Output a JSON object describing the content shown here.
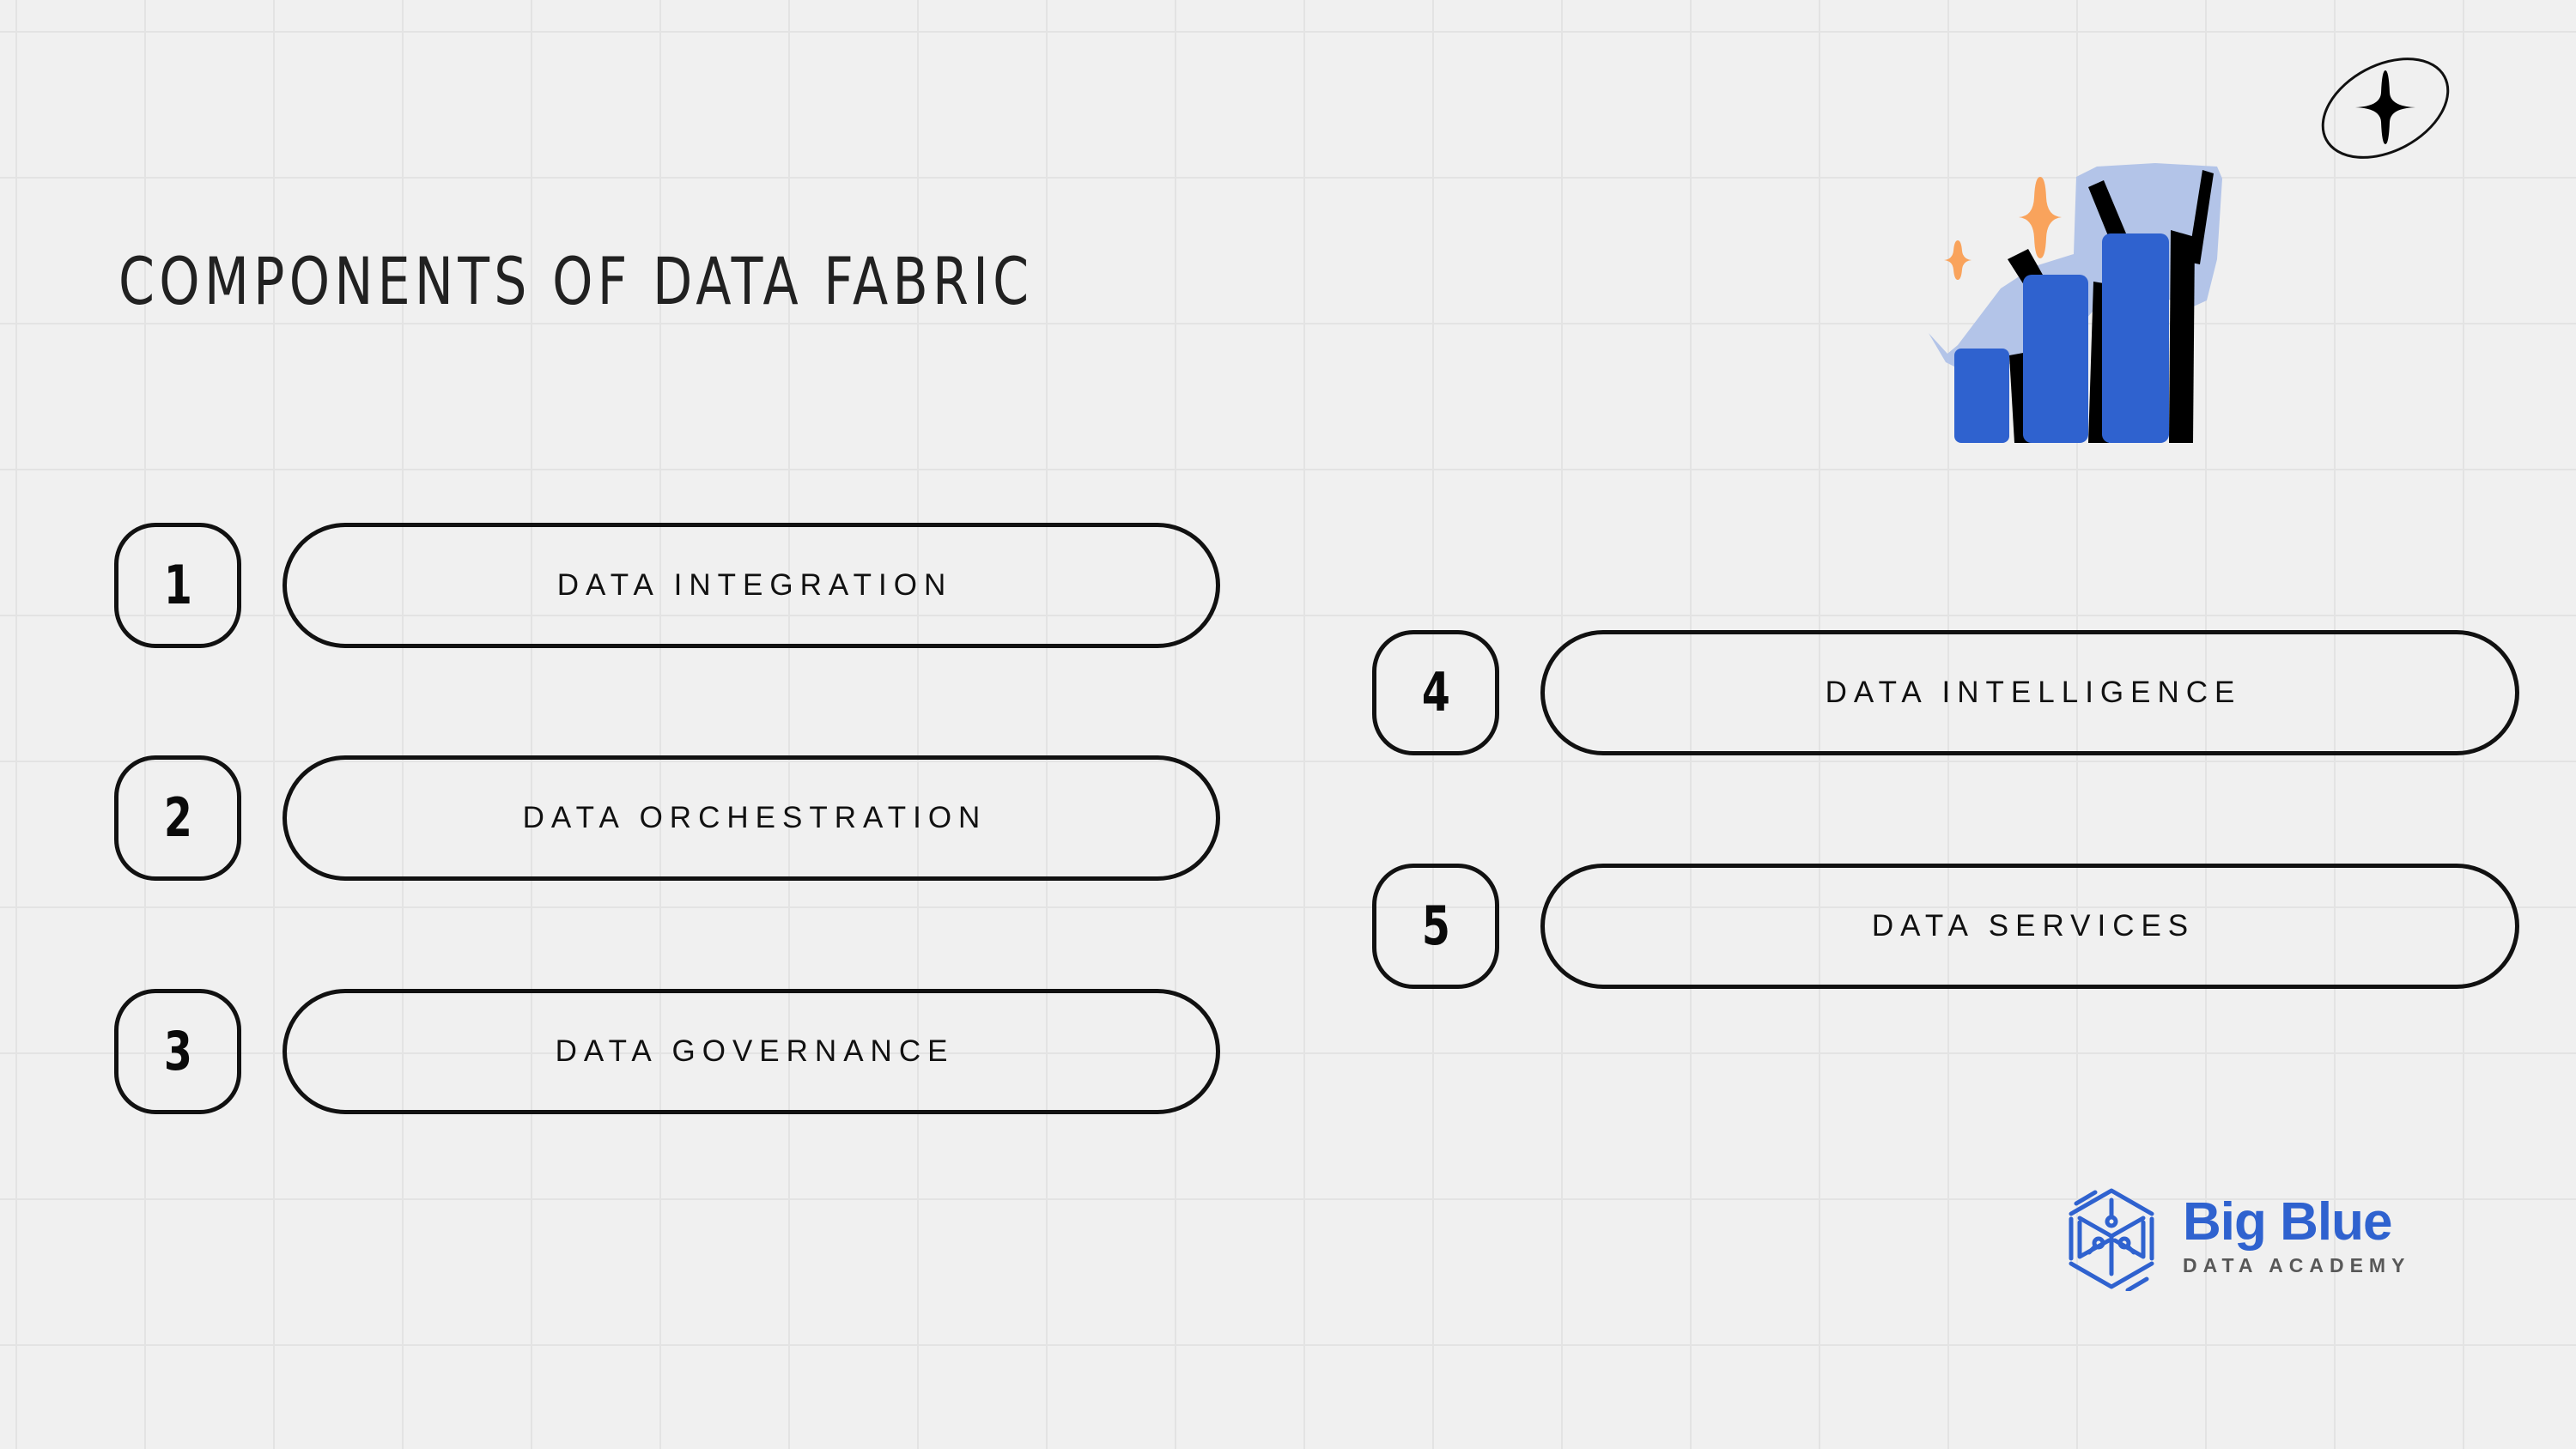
{
  "slide": {
    "title": "COMPONENTS OF DATA FABRIC",
    "background_color": "#f0f0f0",
    "grid_color": "#e3e3e3",
    "outline_color": "#111111"
  },
  "components": {
    "left_column": [
      {
        "number": "1",
        "label": "DATA INTEGRATION"
      },
      {
        "number": "2",
        "label": "DATA ORCHESTRATION"
      },
      {
        "number": "3",
        "label": "DATA GOVERNANCE"
      }
    ],
    "right_column": [
      {
        "number": "4",
        "label": "DATA INTELLIGENCE"
      },
      {
        "number": "5",
        "label": "DATA SERVICES"
      }
    ]
  },
  "decorations": {
    "bar_chart_illustration": {
      "icon": "bar-chart-growth-illustration",
      "bar_color": "#2f62cf",
      "arrow_color": "#b3c4e8",
      "accent_color": "#000000",
      "sparkle_color": "#f9a35c"
    },
    "star_badge": {
      "icon": "four-point-star-in-ellipse-icon",
      "color": "#000000"
    }
  },
  "logo": {
    "mark_icon": "big-blue-hexagon-cube-icon",
    "name": "Big Blue",
    "subtitle": "DATA ACADEMY",
    "brand_color": "#2f62cf",
    "subtitle_color": "#585858"
  }
}
